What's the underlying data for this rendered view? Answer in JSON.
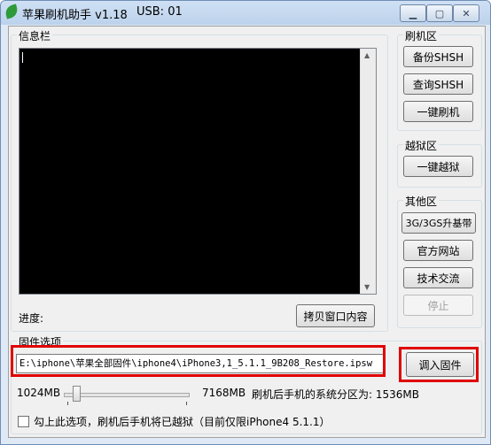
{
  "window": {
    "title": "苹果刷机助手 v1.18",
    "usb": "USB:  01",
    "controls": {
      "minimize": "▁",
      "maximize": "▢",
      "close": "✕"
    }
  },
  "info_panel": {
    "label": "信息栏",
    "progress_label": "进度:",
    "copy_button": "拷贝窗口内容"
  },
  "flash_group": {
    "label": "刷机区",
    "buttons": [
      "备份SHSH",
      "查询SHSH",
      "一键刷机"
    ]
  },
  "jailbreak_group": {
    "label": "越狱区",
    "buttons": [
      "一键越狱"
    ]
  },
  "other_group": {
    "label": "其他区",
    "buttons": [
      "3G/3GS升基带",
      "官方网站",
      "技术交流",
      "停止"
    ]
  },
  "firmware": {
    "label": "固件选项",
    "path": "E:\\iphone\\苹果全部固件\\iphone4\\iPhone3,1_5.1.1_9B208_Restore.ipsw",
    "load_button": "调入固件",
    "slider_min": "1024MB",
    "slider_max": "7168MB",
    "slider_value_fraction": 0.1,
    "partition_text": "刷机后手机的系统分区为: 1536MB",
    "checkbox_text": "勾上此选项，刷机后手机将已越狱（目前仅限iPhone4 5.1.1）"
  },
  "colors": {
    "highlight": "#e00000",
    "console_bg": "#000000"
  }
}
